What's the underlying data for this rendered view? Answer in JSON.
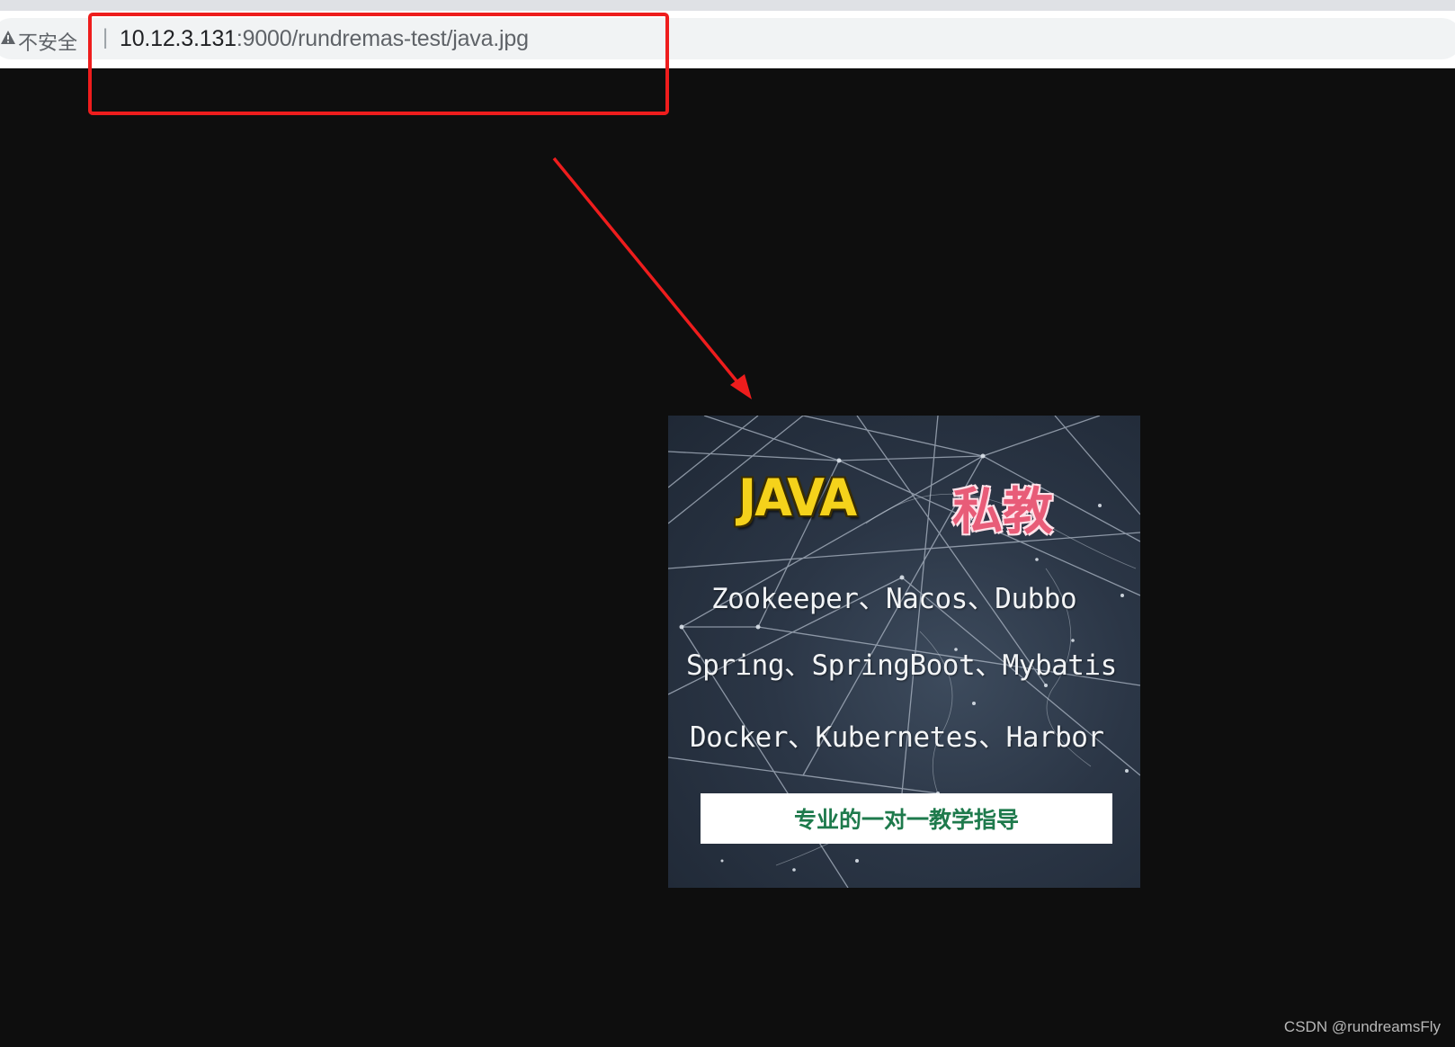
{
  "browser": {
    "security_label": "不安全",
    "separator": "|",
    "url_host": "10.12.3.131",
    "url_rest": ":9000/rundremas-test/java.jpg"
  },
  "poster": {
    "title": "JAVA",
    "subtitle": "私教",
    "lines": [
      "Zookeeper、Nacos、Dubbo",
      "Spring、SpringBoot、Mybatis",
      "Docker、Kubernetes、Harbor"
    ],
    "banner": "专业的一对一教学指导"
  },
  "watermark": "CSDN @rundreamsFly",
  "colors": {
    "annotation_red": "#ee1d1d",
    "page_background": "#0e0e0e",
    "title_yellow": "#f5d21b",
    "subtitle_pink": "#e85c78",
    "banner_text_green": "#1e7a4c"
  },
  "icons": {
    "security": "warning-triangle-icon"
  }
}
